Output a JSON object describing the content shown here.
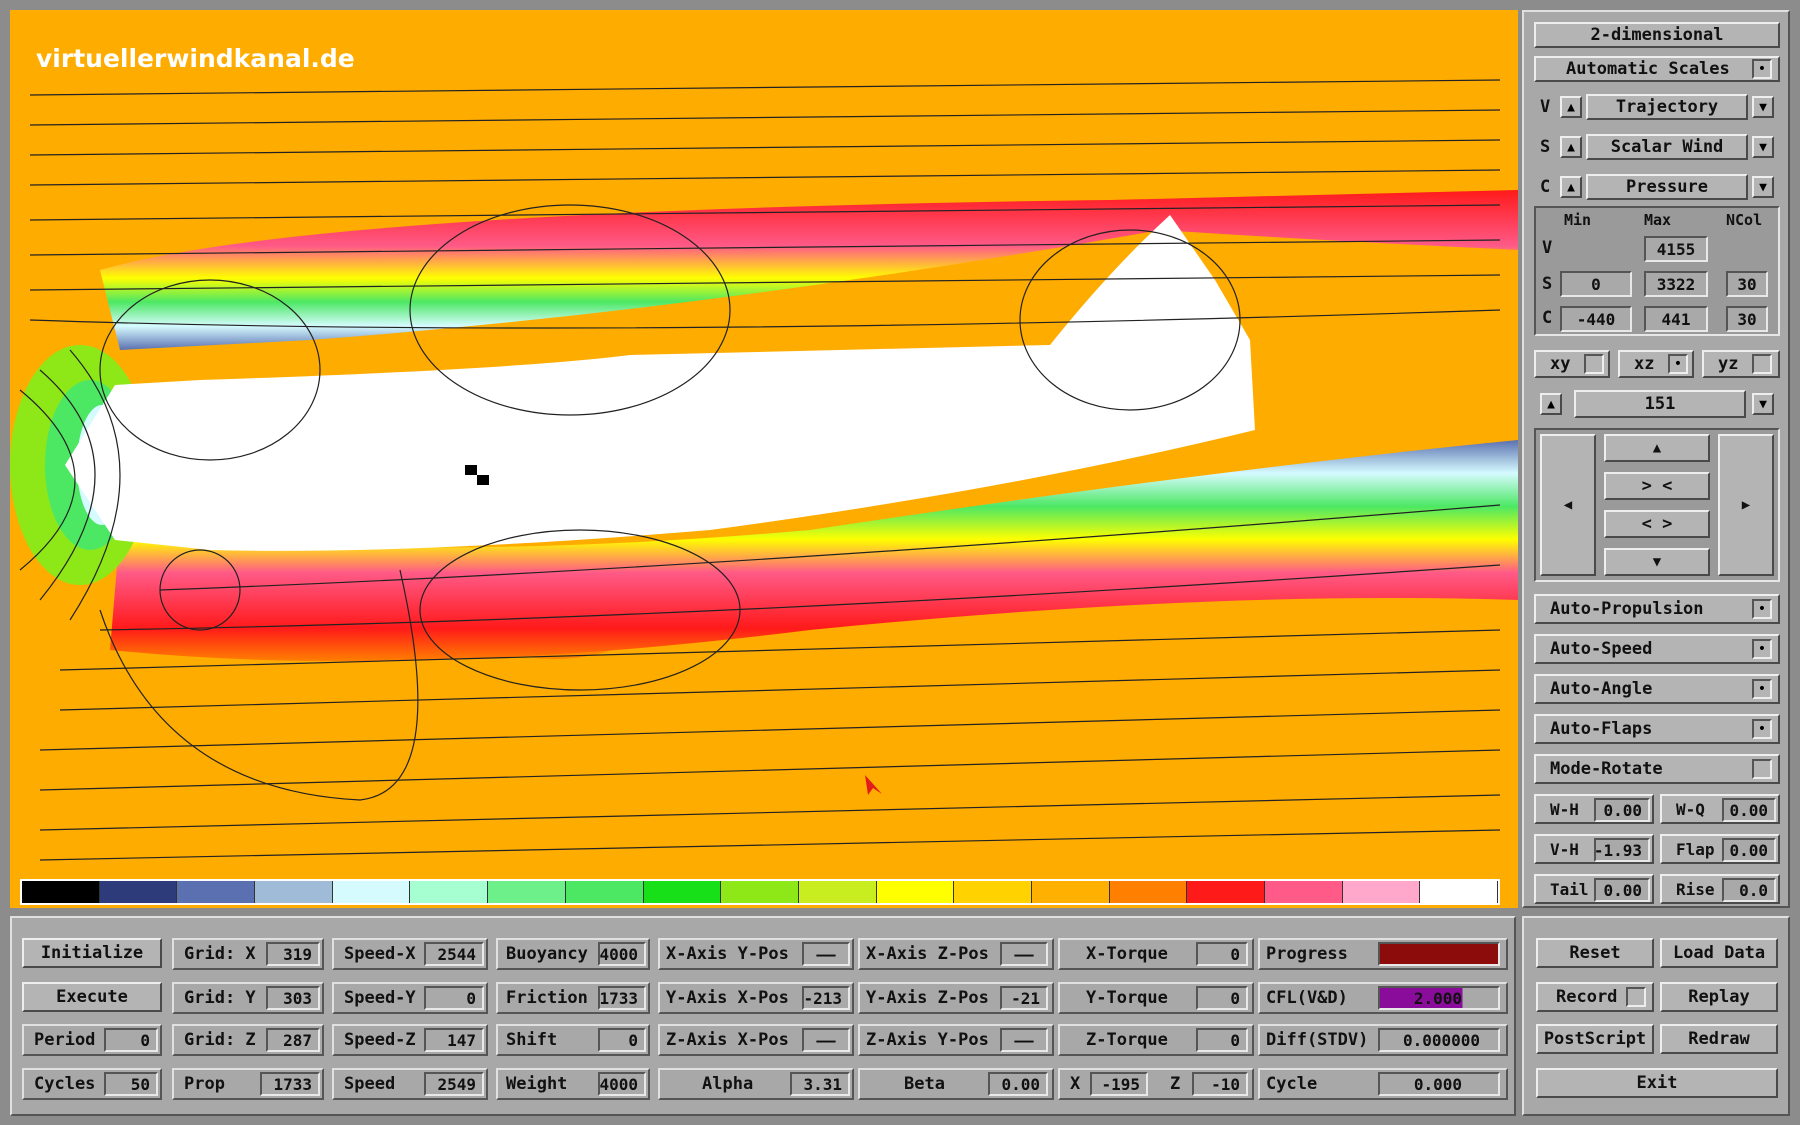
{
  "brand": "virtuellerwindkanal.de",
  "colors": {
    "background": "#ffac00",
    "scale": [
      "#000000",
      "#2e3b7a",
      "#5a70b0",
      "#9fbbd8",
      "#d6fbff",
      "#a6ffd0",
      "#6df08a",
      "#4ce864",
      "#18e018",
      "#8ee818",
      "#c8ee20",
      "#ffff00",
      "#ffd200",
      "#ffb000",
      "#ff8000",
      "#ff1a1a",
      "#ff5a88",
      "#ffa8cc",
      "#ffffff"
    ]
  },
  "right_panel": {
    "mode": "2-dimensional",
    "automatic_scales": "Automatic Scales",
    "v_row": {
      "letter": "V",
      "value": "Trajectory"
    },
    "s_row": {
      "letter": "S",
      "value": "Scalar Wind"
    },
    "c_row": {
      "letter": "C",
      "value": "Pressure"
    },
    "headers": {
      "min": "Min",
      "max": "Max",
      "ncol": "NCol"
    },
    "v": {
      "label": "V",
      "max": "4155"
    },
    "s": {
      "label": "S",
      "min": "0",
      "max": "3322",
      "ncol": "30"
    },
    "c": {
      "label": "C",
      "min": "-440",
      "max": "441",
      "ncol": "30"
    },
    "planes": {
      "xy": "xy",
      "xz": "xz",
      "yz": "yz"
    },
    "slice": "151",
    "auto_propulsion": "Auto-Propulsion",
    "auto_speed": "Auto-Speed",
    "auto_angle": "Auto-Angle",
    "auto_flaps": "Auto-Flaps",
    "mode_rotate": "Mode-Rotate",
    "params": {
      "wh_label": "W-H",
      "wh_value": "0.00",
      "wq_label": "W-Q",
      "wq_value": "0.00",
      "vh_label": "V-H",
      "vh_value": "-1.93",
      "flap_label": "Flap",
      "flap_value": "0.00",
      "tail_label": "Tail",
      "tail_value": "0.00",
      "rise_label": "Rise",
      "rise_value": "0.0"
    }
  },
  "bottom": {
    "initialize": "Initialize",
    "execute": "Execute",
    "period_label": "Period",
    "period_value": "0",
    "cycles_label": "Cycles",
    "cycles_value": "50",
    "gridx_label": "Grid: X",
    "gridx_value": "319",
    "gridy_label": "Grid: Y",
    "gridy_value": "303",
    "gridz_label": "Grid: Z",
    "gridz_value": "287",
    "prop_label": "Prop",
    "prop_value": "1733",
    "speedx_label": "Speed-X",
    "speedx_value": "2544",
    "speedy_label": "Speed-Y",
    "speedy_value": "0",
    "speedz_label": "Speed-Z",
    "speedz_value": "147",
    "speed_label": "Speed",
    "speed_value": "2549",
    "buoyancy_label": "Buoyancy",
    "buoyancy_value": "4000",
    "friction_label": "Friction",
    "friction_value": "1733",
    "shift_label": "Shift",
    "shift_value": "0",
    "weight_label": "Weight",
    "weight_value": "4000",
    "xaxis_ypos_label": "X-Axis Y-Pos",
    "xaxis_ypos_value": "——",
    "yaxis_xpos_label": "Y-Axis X-Pos",
    "yaxis_xpos_value": "-213",
    "zaxis_xpos_label": "Z-Axis X-Pos",
    "zaxis_xpos_value": "——",
    "alpha_label": "Alpha",
    "alpha_value": "3.31",
    "xaxis_zpos_label": "X-Axis Z-Pos",
    "xaxis_zpos_value": "——",
    "yaxis_zpos_label": "Y-Axis Z-Pos",
    "yaxis_zpos_value": "-21",
    "zaxis_ypos_label": "Z-Axis Y-Pos",
    "zaxis_ypos_value": "——",
    "beta_label": "Beta",
    "beta_value": "0.00",
    "xtorque_label": "X-Torque",
    "xtorque_value": "0",
    "ytorque_label": "Y-Torque",
    "ytorque_value": "0",
    "ztorque_label": "Z-Torque",
    "ztorque_value": "0",
    "x_label": "X",
    "x_value": "-195",
    "z_label": "Z",
    "z_value": "-10",
    "progress_label": "Progress",
    "cfl_label": "CFL(V&D)",
    "cfl_value": "2.000",
    "diff_label": "Diff(STDV)",
    "diff_value": "0.000000",
    "cycle_label": "Cycle",
    "cycle_value": "0.000",
    "reset": "Reset",
    "load_data": "Load Data",
    "record": "Record",
    "replay": "Replay",
    "postscript": "PostScript",
    "redraw": "Redraw",
    "exit": "Exit"
  }
}
